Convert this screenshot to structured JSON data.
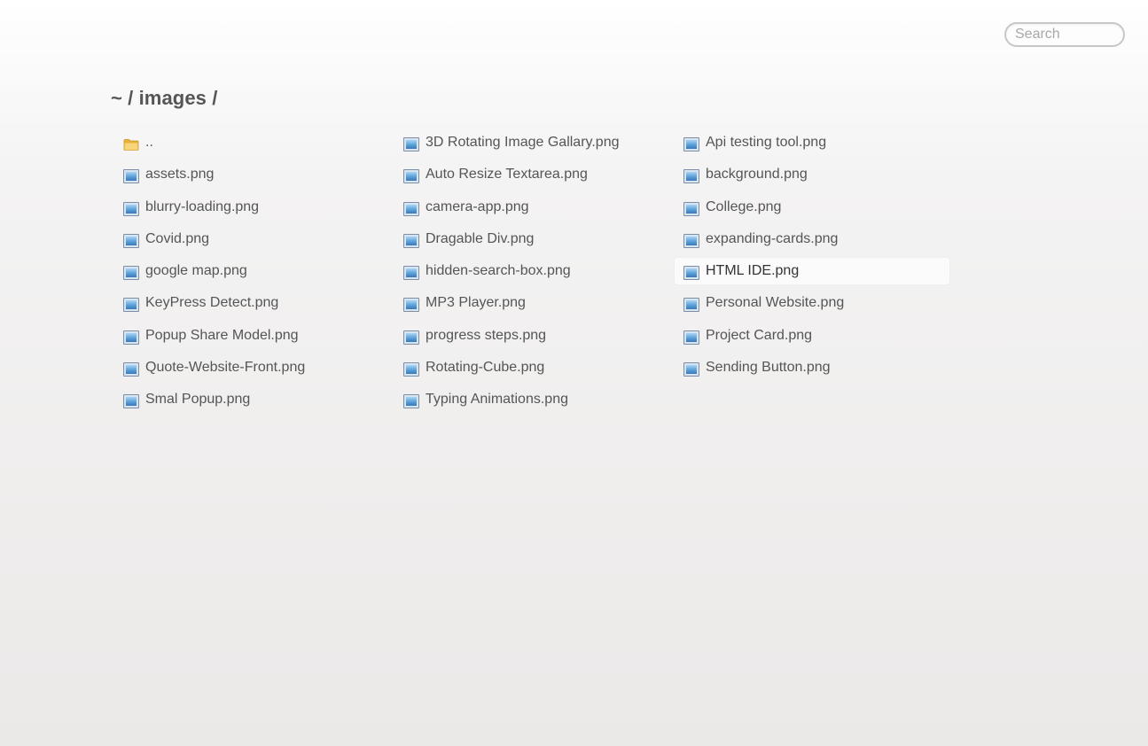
{
  "search": {
    "placeholder": "Search"
  },
  "breadcrumb": {
    "path": "~ / images /"
  },
  "files": [
    {
      "name": "..",
      "icon": "folder-icon"
    },
    {
      "name": "assets.png",
      "icon": "image-file-icon"
    },
    {
      "name": "blurry-loading.png",
      "icon": "image-file-icon"
    },
    {
      "name": "Covid.png",
      "icon": "image-file-icon"
    },
    {
      "name": "google map.png",
      "icon": "image-file-icon"
    },
    {
      "name": "KeyPress Detect.png",
      "icon": "image-file-icon"
    },
    {
      "name": "Popup Share Model.png",
      "icon": "image-file-icon"
    },
    {
      "name": "Quote-Website-Front.png",
      "icon": "image-file-icon"
    },
    {
      "name": "Smal Popup.png",
      "icon": "image-file-icon"
    },
    {
      "name": "3D Rotating Image Gallary.png",
      "icon": "image-file-icon"
    },
    {
      "name": "Auto Resize Textarea.png",
      "icon": "image-file-icon"
    },
    {
      "name": "camera-app.png",
      "icon": "image-file-icon"
    },
    {
      "name": "Dragable Div.png",
      "icon": "image-file-icon"
    },
    {
      "name": "hidden-search-box.png",
      "icon": "image-file-icon"
    },
    {
      "name": "MP3 Player.png",
      "icon": "image-file-icon"
    },
    {
      "name": "progress steps.png",
      "icon": "image-file-icon"
    },
    {
      "name": "Rotating-Cube.png",
      "icon": "image-file-icon"
    },
    {
      "name": "Typing Animations.png",
      "icon": "image-file-icon"
    },
    {
      "name": "Api testing tool.png",
      "icon": "image-file-icon"
    },
    {
      "name": "background.png",
      "icon": "image-file-icon"
    },
    {
      "name": "College.png",
      "icon": "image-file-icon"
    },
    {
      "name": "expanding-cards.png",
      "icon": "image-file-icon"
    },
    {
      "name": "HTML IDE.png",
      "icon": "image-file-icon",
      "hovered": true
    },
    {
      "name": "Personal Website.png",
      "icon": "image-file-icon"
    },
    {
      "name": "Project Card.png",
      "icon": "image-file-icon"
    },
    {
      "name": "Sending Button.png",
      "icon": "image-file-icon"
    }
  ],
  "colors": {
    "text": "#555555",
    "folder": "#f2c14e",
    "image_icon": "#5aa0d8"
  }
}
